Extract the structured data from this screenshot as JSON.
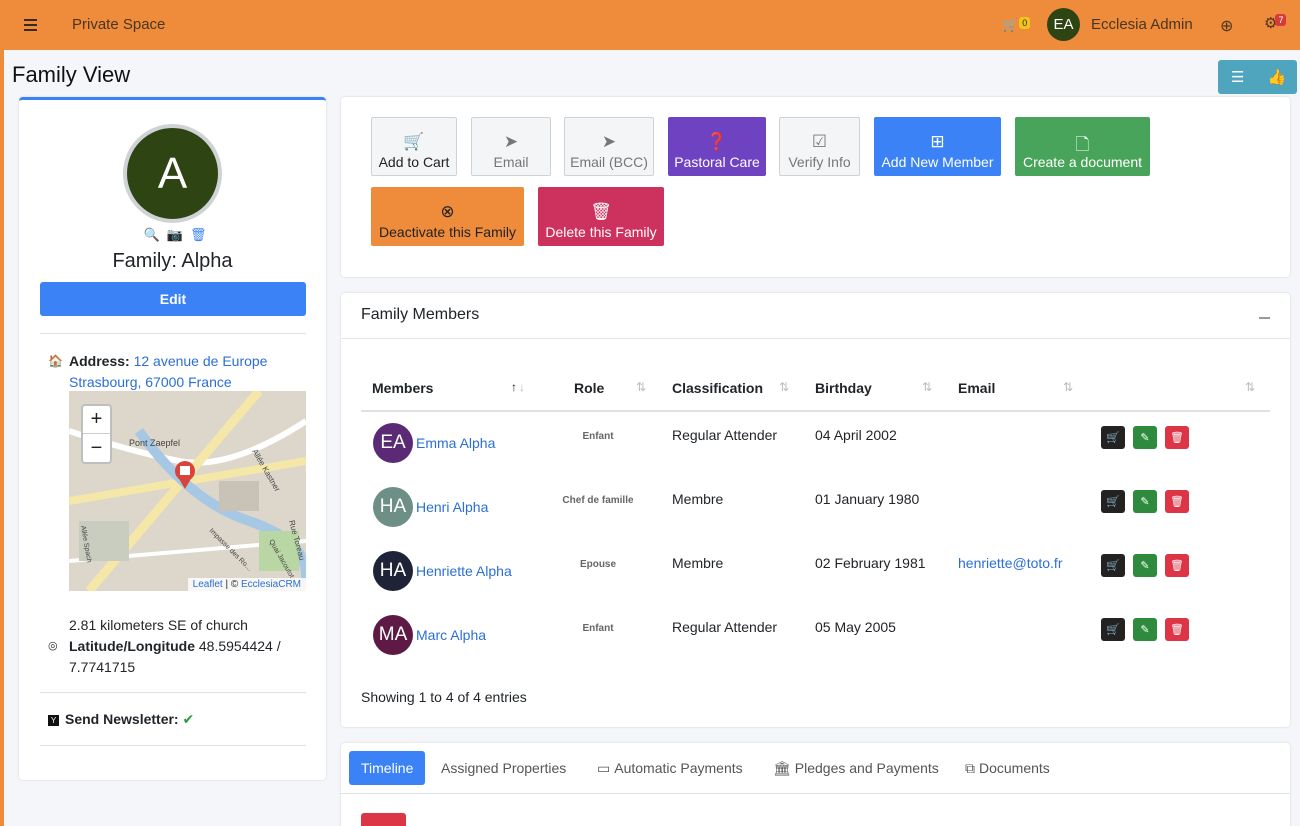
{
  "header": {
    "title": "Private Space",
    "cart_count": "0",
    "user_initials": "EA",
    "user_name": "Ecclesia Admin",
    "notif_count": "7"
  },
  "page": {
    "title": "Family View"
  },
  "family": {
    "initial": "A",
    "name": "Family: Alpha",
    "edit_label": "Edit",
    "address_label": "Address:",
    "address_line1": "12 avenue de Europe",
    "address_line2": "Strasbourg, 67000 France",
    "map_labels": {
      "place": "Pont Zaepfel",
      "street1": "Allée Kastner",
      "street2": "Rue Toreau",
      "street3": "Quai Jacoutot",
      "street4": "Impasse des Ro…",
      "street5": "Allée Spach"
    },
    "map_zoom_in": "+",
    "map_zoom_out": "−",
    "map_attr_leaflet": "Leaflet",
    "map_attr_sep": " | © ",
    "map_attr_crm": "EcclesiaCRM",
    "distance": "2.81 kilometers SE of church",
    "latlon_label": "Latitude/Longitude",
    "latlon_value": "48.5954424 / 7.7741715",
    "newsletter_label": "Send Newsletter:"
  },
  "actions": [
    {
      "label": "Add to Cart",
      "icon": "cart-plus-icon",
      "bg": "#f4f5f6",
      "color": "#222"
    },
    {
      "label": "Email",
      "icon": "paper-plane-icon",
      "bg": "#f4f5f6",
      "color": "#777"
    },
    {
      "label": "Email (BCC)",
      "icon": "paper-plane-icon",
      "bg": "#f4f5f6",
      "color": "#777"
    },
    {
      "label": "Pastoral Care",
      "icon": "question-circle-icon",
      "bg": "#6f42c1",
      "color": "#fff"
    },
    {
      "label": "Verify Info",
      "icon": "check-square-icon",
      "bg": "#f4f5f6",
      "color": "#777"
    },
    {
      "label": "Add New Member",
      "icon": "plus-square-icon",
      "bg": "#3b82f6",
      "color": "#fff"
    },
    {
      "label": "Create a document",
      "icon": "file-icon",
      "bg": "#48a45a",
      "color": "#fff"
    },
    {
      "label": "Deactivate this Family",
      "icon": "times-circle-icon",
      "bg": "#ef8c3b",
      "color": "#222"
    },
    {
      "label": "Delete this Family",
      "icon": "trash-icon",
      "bg": "#cc325d",
      "color": "#fff"
    }
  ],
  "members_card": {
    "title": "Family Members",
    "columns": [
      "Members",
      "Role",
      "Classification",
      "Birthday",
      "Email"
    ],
    "showing": "Showing 1 to 4 of 4 entries"
  },
  "members": [
    {
      "initials": "EA",
      "name": "Emma Alpha",
      "role": "Enfant",
      "classification": "Regular Attender",
      "birthday": "04 April 2002",
      "email": "",
      "color": "#5b2a75"
    },
    {
      "initials": "HA",
      "name": "Henri Alpha",
      "role": "Chef de famille",
      "classification": "Membre",
      "birthday": "01 January 1980",
      "email": "",
      "color": "#6e8f86"
    },
    {
      "initials": "HA",
      "name": "Henriette Alpha",
      "role": "Epouse",
      "classification": "Membre",
      "birthday": "02 February 1981",
      "email": "henriette@toto.fr",
      "color": "#1e2338"
    },
    {
      "initials": "MA",
      "name": "Marc Alpha",
      "role": "Enfant",
      "classification": "Regular Attender",
      "birthday": "05 May 2005",
      "email": "",
      "color": "#5e1a45"
    }
  ],
  "tabs": [
    {
      "label": "Timeline",
      "icon": ""
    },
    {
      "label": "Assigned Properties",
      "icon": ""
    },
    {
      "label": "Automatic Payments",
      "icon": "credit-card-icon"
    },
    {
      "label": "Pledges and Payments",
      "icon": "bank-icon"
    },
    {
      "label": "Documents",
      "icon": "copy-icon"
    }
  ],
  "colors": {
    "topbar": "#ef8c3b",
    "primary": "#3b82f6",
    "link": "#2b6fd6",
    "danger": "#dc3545",
    "success": "#48a45a"
  }
}
